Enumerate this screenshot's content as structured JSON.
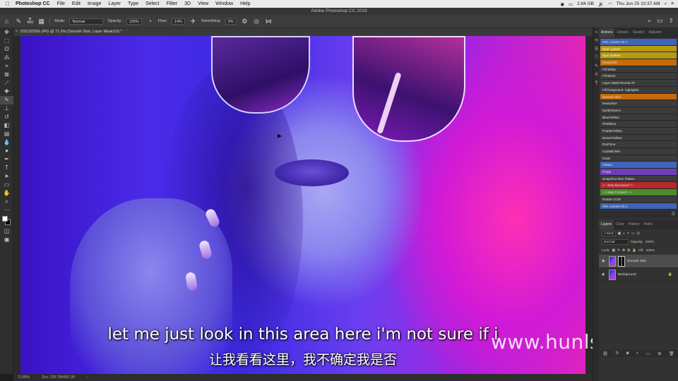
{
  "menubar": {
    "apple": "",
    "app": "Photoshop CC",
    "items": [
      "File",
      "Edit",
      "Image",
      "Layer",
      "Type",
      "Select",
      "Filter",
      "3D",
      "View",
      "Window",
      "Help"
    ],
    "memory": "2.84 GB",
    "datetime": "Thu Jun 25  10:37 AM"
  },
  "titlebar": {
    "title": "Adobe Photoshop CC 2019"
  },
  "options": {
    "brush_size": "480",
    "mode_label": "Mode:",
    "mode_value": "Normal",
    "opacity_label": "Opacity:",
    "opacity_value": "100%",
    "flow_label": "Flow:",
    "flow_value": "14%",
    "smoothing_label": "Smoothing:",
    "smoothing_value": "0%"
  },
  "document": {
    "tab_title": "DSC0259G.JPG @ 71.9% (Smooth Skin, Layer Mask/16) *"
  },
  "subtitles": {
    "english": "let me just look in this area here i'm not sure if i",
    "chinese": "让我看看这里，我不确定我是否"
  },
  "watermark": "www.hunls.com",
  "statusbar": {
    "zoom": "71.85%",
    "doc": "Doc: 235.7M/493.1M"
  },
  "panel_tabs": [
    "Actions",
    "Librarie",
    "Swatch",
    "Adjustm"
  ],
  "actions": [
    {
      "label": "SRL Actions 20.4",
      "color": "blue"
    },
    {
      "label": "Spot Lighten",
      "color": "yellow"
    },
    {
      "label": "Spot Darken",
      "color": "yellow"
    },
    {
      "label": "DeepDark",
      "color": "orange"
    },
    {
      "label": "Fill White",
      "color": "default"
    },
    {
      "label": "Fill Black",
      "color": "default"
    },
    {
      "label": "Layer Mask Reveal All",
      "color": "default"
    },
    {
      "label": "Fill foreground- highlights",
      "color": "default"
    },
    {
      "label": "Smooth Skin",
      "color": "orange"
    },
    {
      "label": "Neutralize",
      "color": "default"
    },
    {
      "label": "EyeEnhance",
      "color": "default"
    },
    {
      "label": "Blue/Yellow",
      "color": "default"
    },
    {
      "label": "Pink/Blue",
      "color": "default"
    },
    {
      "label": "Purple/Yellow",
      "color": "default"
    },
    {
      "label": "Brown/Yellow",
      "color": "default"
    },
    {
      "label": "DuoTone",
      "color": "default"
    },
    {
      "label": "CrystalClear",
      "color": "default"
    },
    {
      "label": "Grain",
      "color": "default"
    },
    {
      "label": "Flatten",
      "color": "blue"
    },
    {
      "label": "Purge",
      "color": "purple"
    },
    {
      "label": "SnapShot then Flatten",
      "color": "default"
    },
    {
      "label": "<-- Step Backward <--",
      "color": "red"
    },
    {
      "label": "--> Step Forward -->",
      "color": "green"
    },
    {
      "label": "Rotate CCW",
      "color": "default"
    },
    {
      "label": "SRL Actions 20.4",
      "color": "blue"
    }
  ],
  "layer_tabs": [
    "Layers",
    "Color",
    "History",
    "Paths"
  ],
  "layers_panel": {
    "kind_label": "Kind",
    "blend_mode": "Normal",
    "opacity_label": "Opacity:",
    "opacity_value": "100%",
    "lock_label": "Lock:",
    "fill_label": "Fill:",
    "fill_value": "100%"
  },
  "layers": [
    {
      "name": "Smooth Skin",
      "selected": true,
      "has_mask": true
    },
    {
      "name": "Background",
      "selected": false,
      "has_mask": false
    }
  ]
}
